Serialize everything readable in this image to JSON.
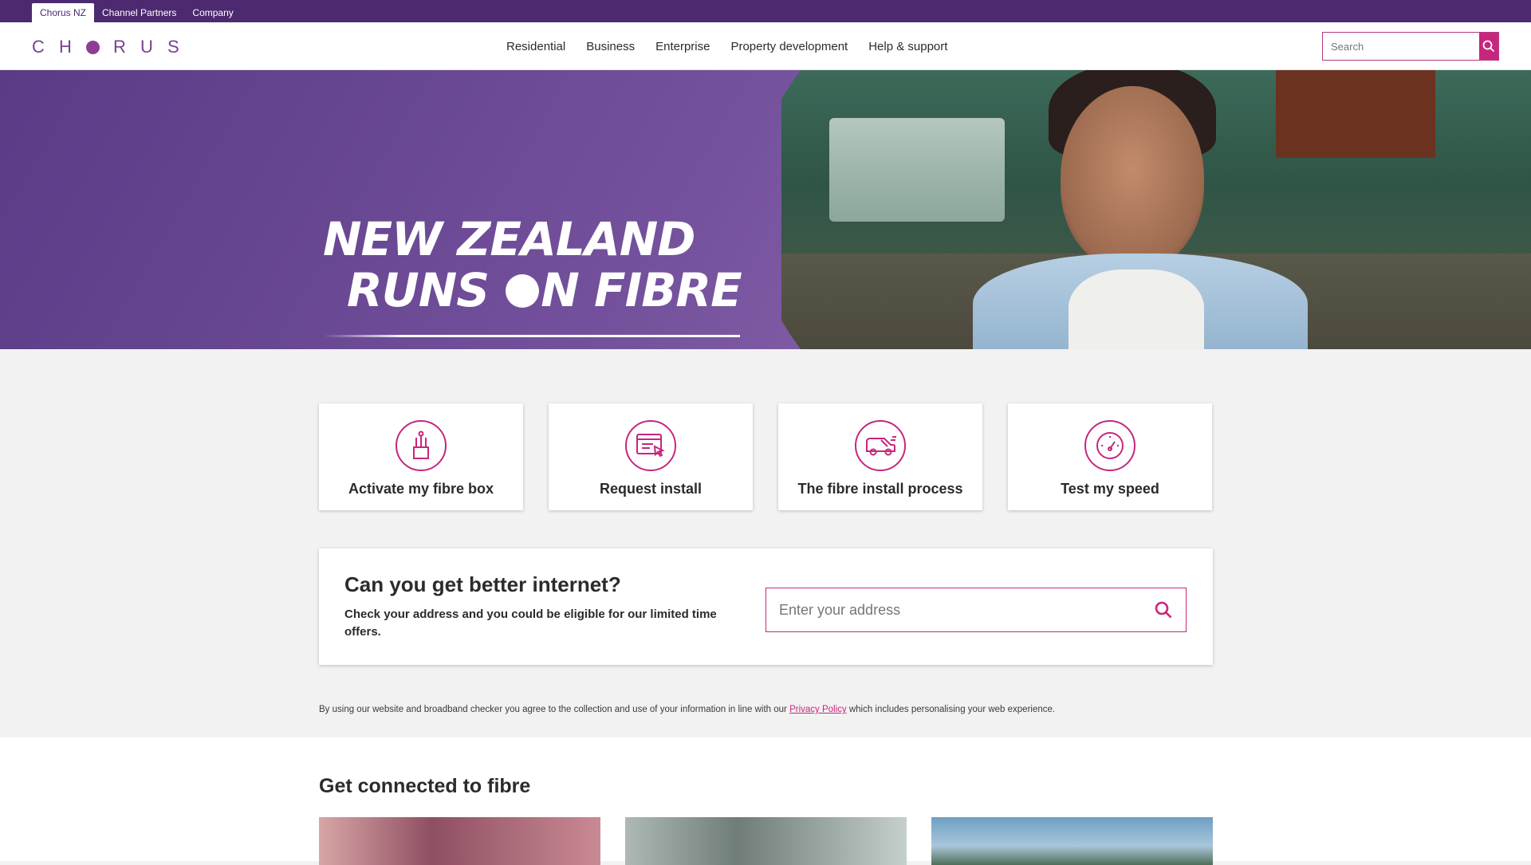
{
  "utility_tabs": [
    {
      "label": "Chorus NZ"
    },
    {
      "label": "Channel Partners"
    },
    {
      "label": "Company"
    }
  ],
  "logo": {
    "text_letters": [
      "C",
      "H",
      "R",
      "U",
      "S"
    ]
  },
  "nav": [
    {
      "label": "Residential"
    },
    {
      "label": "Business"
    },
    {
      "label": "Enterprise"
    },
    {
      "label": "Property development"
    },
    {
      "label": "Help & support"
    }
  ],
  "search": {
    "placeholder": "Search"
  },
  "hero": {
    "title_line1": "NEW ZEALAND",
    "title_line2_a": "RUNS",
    "title_line2_b": "N FIBRE"
  },
  "quick_links": [
    {
      "label": "Activate my fibre box",
      "icon": "fibre-box-icon"
    },
    {
      "label": "Request install",
      "icon": "browser-click-icon"
    },
    {
      "label": "The fibre install process",
      "icon": "van-icon"
    },
    {
      "label": "Test my speed",
      "icon": "speedometer-icon"
    }
  ],
  "checker": {
    "title": "Can you get better internet?",
    "description": "Check your address and you could be eligible for our limited time offers.",
    "address_placeholder": "Enter your address"
  },
  "privacy": {
    "before": "By using our website and broadband checker you agree to the collection and use of your information in line with our ",
    "link": "Privacy Policy",
    "after": " which includes personalising your web experience."
  },
  "lower": {
    "title": "Get connected to fibre"
  },
  "colors": {
    "brand_purple": "#4d2a6f",
    "accent_pink": "#c7267d"
  }
}
